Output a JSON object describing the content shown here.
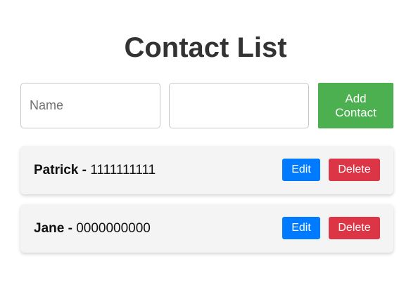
{
  "header": {
    "title": "Contact List"
  },
  "form": {
    "name_placeholder": "Name",
    "name_value": "",
    "phone_placeholder": "",
    "phone_value": "",
    "add_label": "Add Contact"
  },
  "contacts": [
    {
      "name": "Patrick",
      "separator": " - ",
      "phone": "1111111111",
      "edit_label": "Edit",
      "delete_label": "Delete"
    },
    {
      "name": "Jane",
      "separator": " - ",
      "phone": "0000000000",
      "edit_label": "Edit",
      "delete_label": "Delete"
    }
  ],
  "colors": {
    "add_button": "#4caf50",
    "edit_button": "#007bff",
    "delete_button": "#dc3545",
    "card_background": "#f4f4f4"
  }
}
